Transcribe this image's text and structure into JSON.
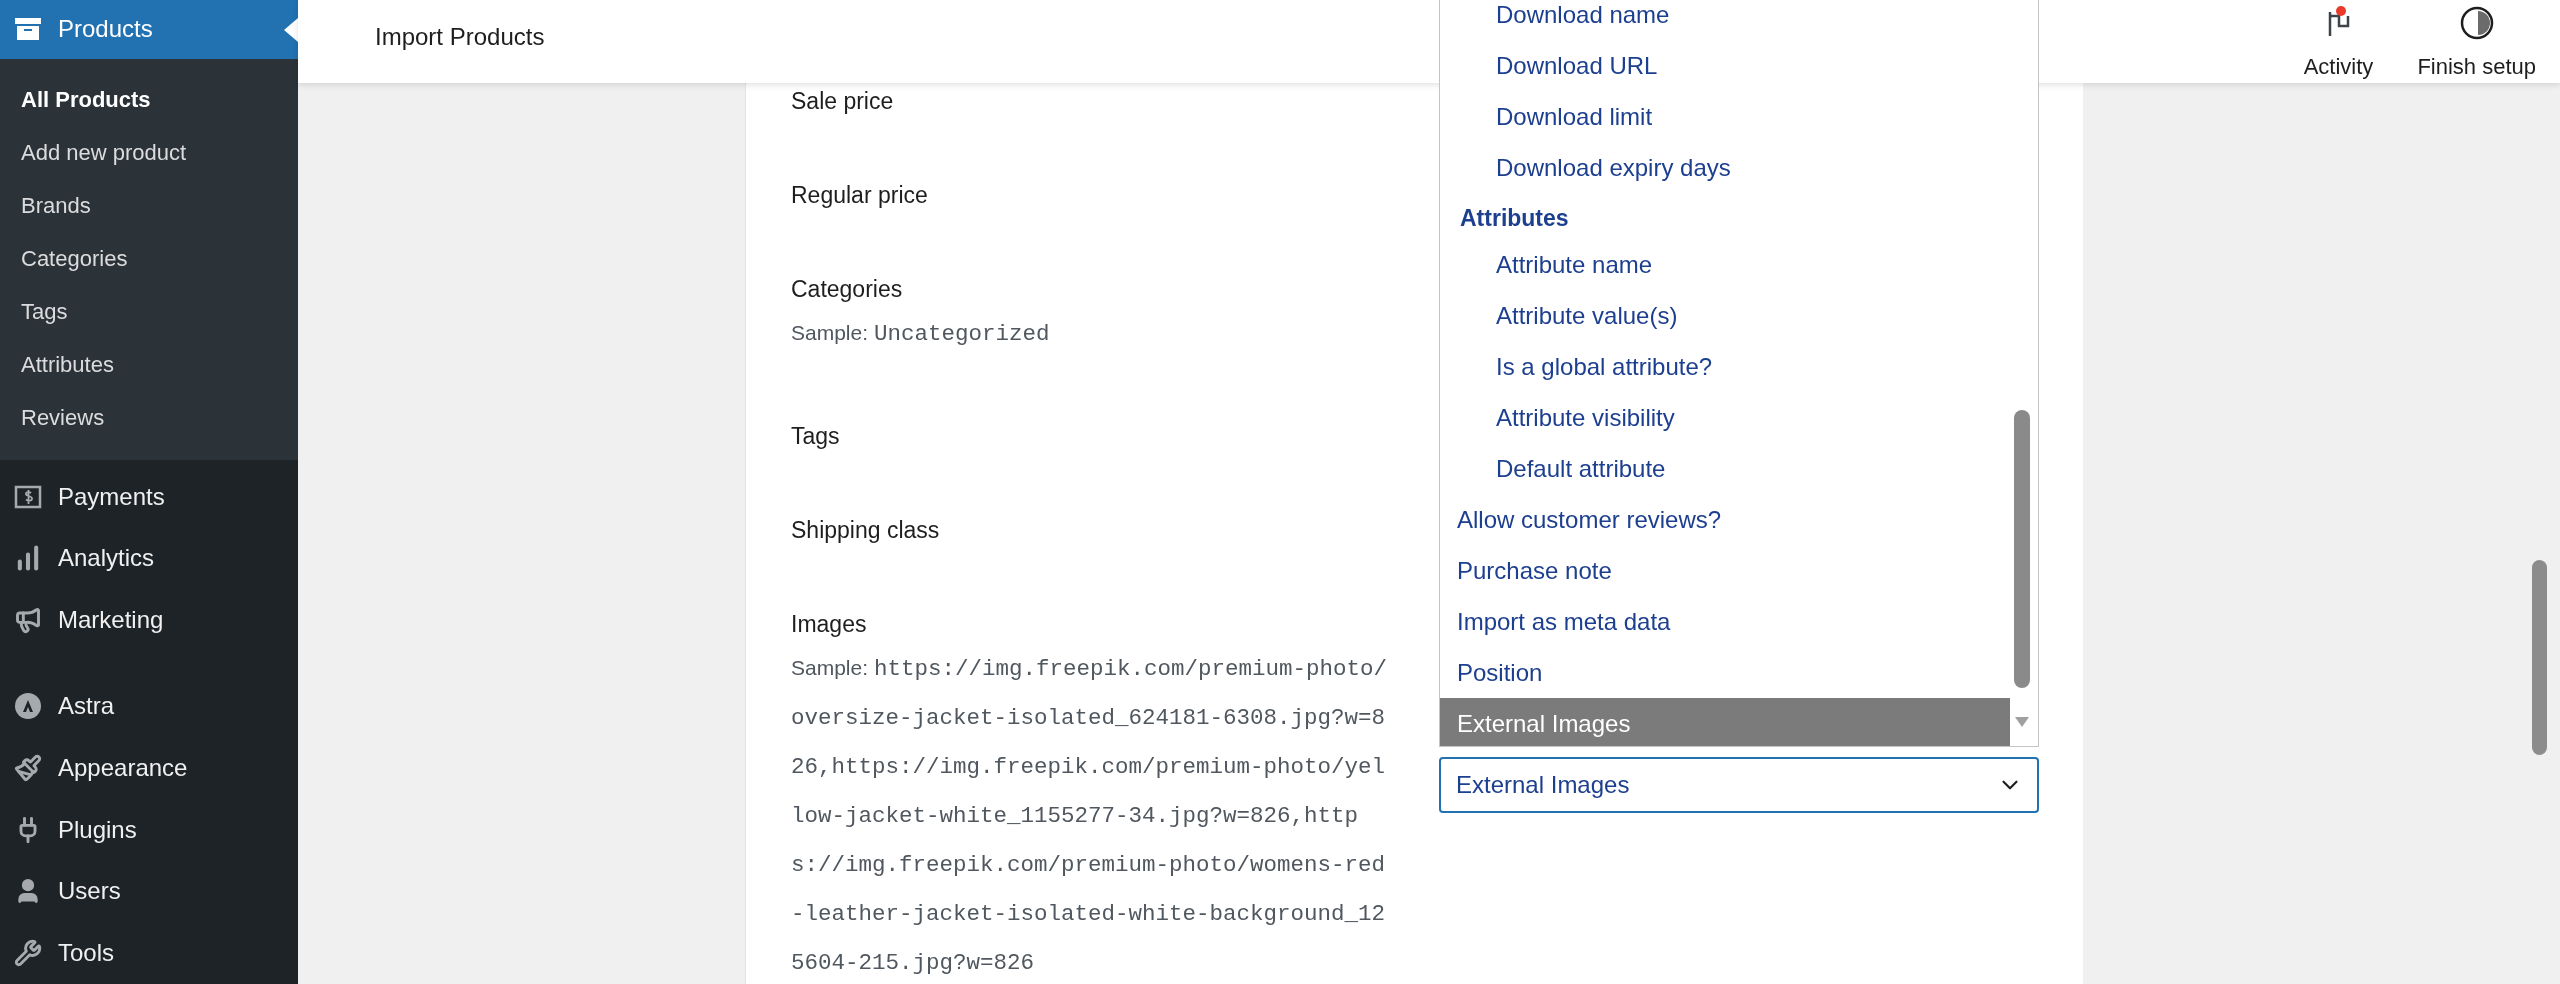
{
  "sidebar": {
    "items": [
      {
        "label": "Products",
        "selected": true,
        "children": [
          {
            "label": "All Products",
            "selected": true
          },
          {
            "label": "Add new product",
            "selected": false
          },
          {
            "label": "Brands",
            "selected": false
          },
          {
            "label": "Categories",
            "selected": false
          },
          {
            "label": "Tags",
            "selected": false
          },
          {
            "label": "Attributes",
            "selected": false
          },
          {
            "label": "Reviews",
            "selected": false
          }
        ]
      },
      {
        "label": "Payments",
        "selected": false
      },
      {
        "label": "Analytics",
        "selected": false
      },
      {
        "label": "Marketing",
        "selected": false
      },
      {
        "label": "Astra",
        "selected": false
      },
      {
        "label": "Appearance",
        "selected": false
      },
      {
        "label": "Plugins",
        "selected": false
      },
      {
        "label": "Users",
        "selected": false
      },
      {
        "label": "Tools",
        "selected": false
      }
    ]
  },
  "header": {
    "title": "Import Products",
    "actions": [
      {
        "label": "Activity",
        "badge": true
      },
      {
        "label": "Finish setup"
      }
    ]
  },
  "fields": [
    {
      "label": "Sale price"
    },
    {
      "label": "Regular price"
    },
    {
      "label": "Categories",
      "sample_label": "Sample:",
      "sample": "Uncategorized"
    },
    {
      "label": "Tags"
    },
    {
      "label": "Shipping class"
    },
    {
      "label": "Images",
      "sample_label": "Sample:",
      "sample": "https://img.freepik.com/premium-photo/oversize-jacket-isolated_624181-6308.jpg?w=826,https://img.freepik.com/premium-photo/yellow-jacket-white_1155277-34.jpg?w=826,https://img.freepik.com/premium-photo/womens-red-leather-jacket-isolated-white-background_125604-215.jpg?w=826"
    }
  ],
  "dropdown": {
    "options": [
      {
        "kind": "group",
        "children": [
          {
            "label": "Download name",
            "selected": false
          },
          {
            "label": "Download URL",
            "selected": false
          },
          {
            "label": "Download limit",
            "selected": false
          },
          {
            "label": "Download expiry days",
            "selected": false
          }
        ]
      },
      {
        "kind": "group",
        "label": "Attributes",
        "children": [
          {
            "label": "Attribute name",
            "selected": false
          },
          {
            "label": "Attribute value(s)",
            "selected": false
          },
          {
            "label": "Is a global attribute?",
            "selected": false
          },
          {
            "label": "Attribute visibility",
            "selected": false
          },
          {
            "label": "Default attribute",
            "selected": false
          }
        ]
      },
      {
        "kind": "option",
        "label": "Allow customer reviews?",
        "selected": false
      },
      {
        "kind": "option",
        "label": "Purchase note",
        "selected": false
      },
      {
        "kind": "option",
        "label": "Import as meta data",
        "selected": false
      },
      {
        "kind": "option",
        "label": "Position",
        "selected": false
      },
      {
        "kind": "option",
        "label": "External Images",
        "selected": true
      }
    ],
    "value": "External Images"
  }
}
